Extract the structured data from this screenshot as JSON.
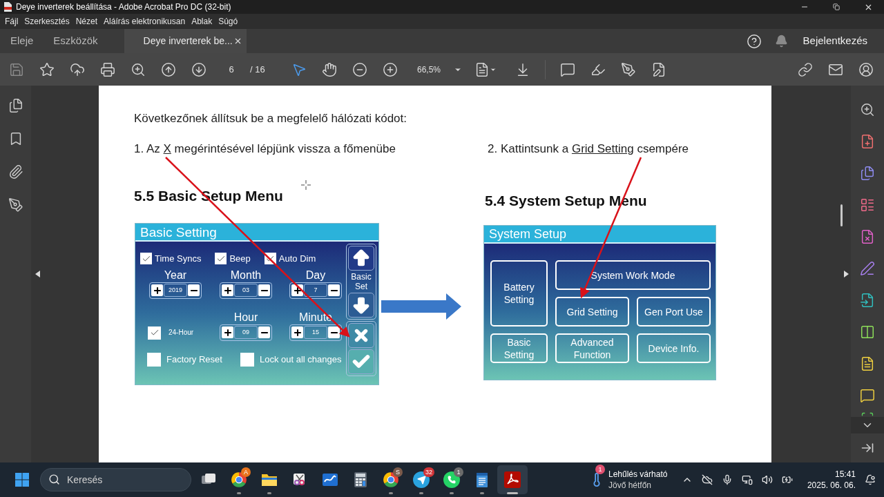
{
  "window": {
    "title": "Deye inverterek beállítása - Adobe Acrobat Pro DC (32-bit)"
  },
  "menu": [
    "Fájl",
    "Szerkesztés",
    "Nézet",
    "Aláírás elektronikusan",
    "Ablak",
    "Súgó"
  ],
  "tabs": [
    {
      "label": "Eleje",
      "selected": false
    },
    {
      "label": "Eszközök",
      "selected": false
    },
    {
      "label": "Deye inverterek be...",
      "selected": true
    }
  ],
  "sign_in": "Bejelentkezés",
  "toolbar": {
    "page": "6",
    "page_count": "/ 16",
    "zoom": "66,5%"
  },
  "document": {
    "intro": "Következőnek állítsuk be a megfelelő hálózati kódot:",
    "columns": [
      {
        "step": {
          "before": "1. Az ",
          "underlined": "X",
          "after": " megérintésével lépjünk vissza a főmenübe"
        },
        "heading": "5.5 Basic Setup Menu",
        "screen": {
          "kind": "basic_setting",
          "title": "Basic Setting",
          "toggles": [
            {
              "label": "Time Syncs",
              "checked": true
            },
            {
              "label": "Beep",
              "checked": true
            },
            {
              "label": "Auto Dim",
              "checked": true
            }
          ],
          "date_fields": [
            {
              "label": "Year",
              "value": "2019"
            },
            {
              "label": "Month",
              "value": "03"
            },
            {
              "label": "Day",
              "value": "7"
            }
          ],
          "hour_format": {
            "label": "24-Hour",
            "checked": true
          },
          "time_fields": [
            {
              "label": "Hour",
              "value": "09"
            },
            {
              "label": "Minute",
              "value": "15"
            }
          ],
          "options": [
            {
              "label": "Factory Reset",
              "checked": false
            },
            {
              "label": "Lock out all changes",
              "checked": false
            }
          ],
          "side_label": "Basic Set"
        }
      },
      {
        "step": {
          "before": "2. Kattintsunk a ",
          "underlined": "Grid Setting",
          "after": " csempére"
        },
        "heading": "5.4 System Setup Menu",
        "screen": {
          "kind": "system_setup",
          "title": "System Setup",
          "tiles": [
            "Battery Setting",
            "System Work Mode",
            "Grid Setting",
            "Gen Port Use",
            "Basic Setting",
            "Advanced Function",
            "Device Info."
          ]
        }
      }
    ]
  },
  "taskbar": {
    "search_placeholder": "Keresés",
    "apps": [
      {
        "kind": "task_view",
        "running": false,
        "selected": false
      },
      {
        "kind": "chrome",
        "running": true,
        "selected": false,
        "badge": {
          "text": "A",
          "color": "#e8731c"
        }
      },
      {
        "kind": "folder",
        "running": true,
        "selected": false
      },
      {
        "kind": "snipping",
        "running": false,
        "selected": false
      },
      {
        "kind": "whiteboard",
        "running": false,
        "selected": false
      },
      {
        "kind": "calculator",
        "running": false,
        "selected": false
      },
      {
        "kind": "chrome",
        "running": true,
        "selected": false,
        "badge": {
          "text": "S",
          "color": "#7a5a4a"
        }
      },
      {
        "kind": "telegram",
        "running": true,
        "selected": false,
        "badge": {
          "text": "32",
          "color": "#d13438"
        }
      },
      {
        "kind": "whatsapp",
        "running": true,
        "selected": false,
        "badge": {
          "text": "1",
          "color": "#6b6b6b"
        }
      },
      {
        "kind": "notepad",
        "running": true,
        "selected": false
      },
      {
        "kind": "acrobat",
        "running": true,
        "selected": true
      }
    ],
    "weather": {
      "badge": "1",
      "title": "Lehűlés várható",
      "subtitle": "Jövő hétfőn"
    },
    "clock": {
      "time": "15:41",
      "date": "2025. 06. 06."
    }
  }
}
